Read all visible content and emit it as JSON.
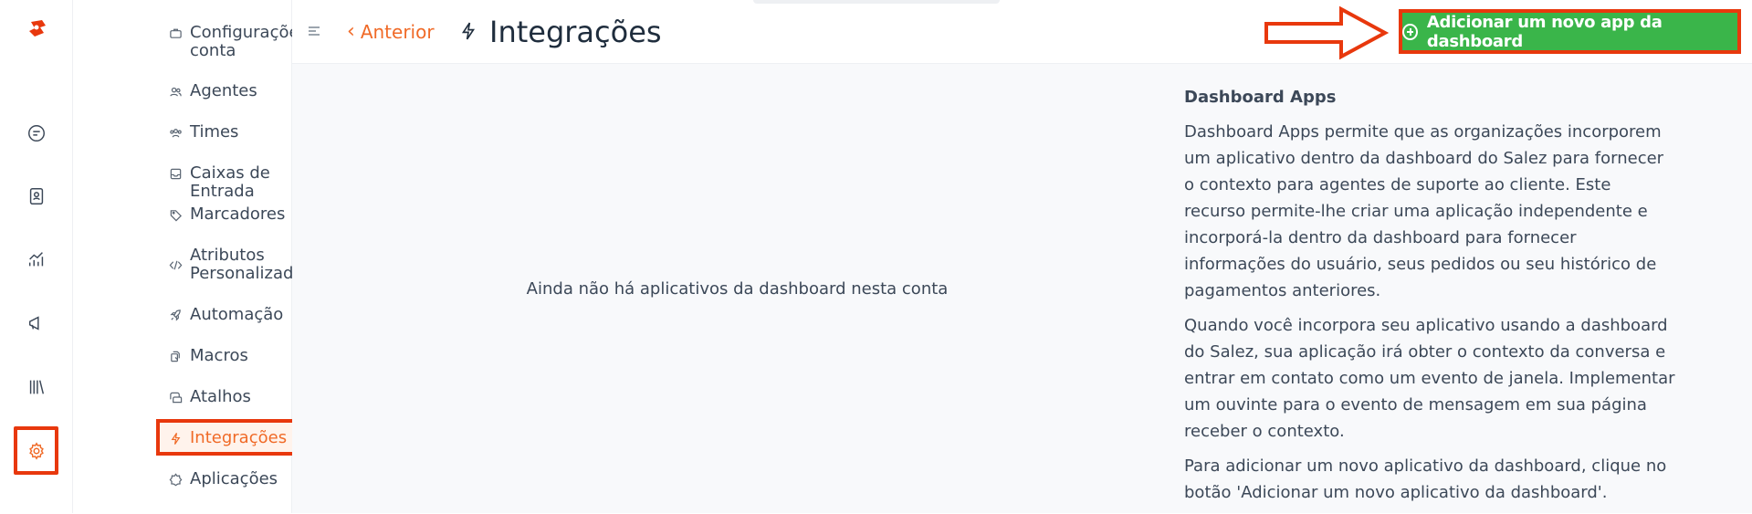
{
  "sidebar": {
    "items": [
      {
        "label": "Configurações da conta",
        "icon": "briefcase-icon"
      },
      {
        "label": "Agentes",
        "icon": "people-icon"
      },
      {
        "label": "Times",
        "icon": "team-icon"
      },
      {
        "label": "Caixas de Entrada",
        "icon": "inbox-icon"
      },
      {
        "label": "Marcadores",
        "icon": "tag-icon"
      },
      {
        "label": "Atributos Personalizados",
        "icon": "code-icon"
      },
      {
        "label": "Automação",
        "icon": "rocket-icon"
      },
      {
        "label": "Macros",
        "icon": "macro-icon"
      },
      {
        "label": "Atalhos",
        "icon": "chat-bubbles-icon"
      },
      {
        "label": "Integrações",
        "icon": "flash-icon"
      },
      {
        "label": "Aplicações",
        "icon": "star-badge-icon"
      }
    ]
  },
  "header": {
    "back_label": "Anterior",
    "title": "Integrações",
    "add_button_label": "Adicionar um novo app da dashboard"
  },
  "main": {
    "empty_message": "Ainda não há aplicativos da dashboard nesta conta"
  },
  "help": {
    "title": "Dashboard Apps",
    "paragraphs": [
      "Dashboard Apps permite que as organizações incorporem um aplicativo dentro da dashboard do Salez para fornecer o contexto para agentes de suporte ao cliente. Este recurso permite-lhe criar uma aplicação independente e incorporá-la dentro da dashboard para fornecer informações do usuário, seus pedidos ou seu histórico de pagamentos anteriores.",
      "Quando você incorpora seu aplicativo usando a dashboard do Salez, sua aplicação irá obter o contexto da conversa e entrar em contato como um evento de janela. Implementar um ouvinte para o evento de mensagem em sua página receber o contexto.",
      "Para adicionar um novo aplicativo da dashboard, clique no botão 'Adicionar um novo aplicativo da dashboard'."
    ]
  },
  "colors": {
    "accent": "#f06a27",
    "highlight_border": "#e8380d",
    "add_button_bg": "#3ab54a"
  }
}
